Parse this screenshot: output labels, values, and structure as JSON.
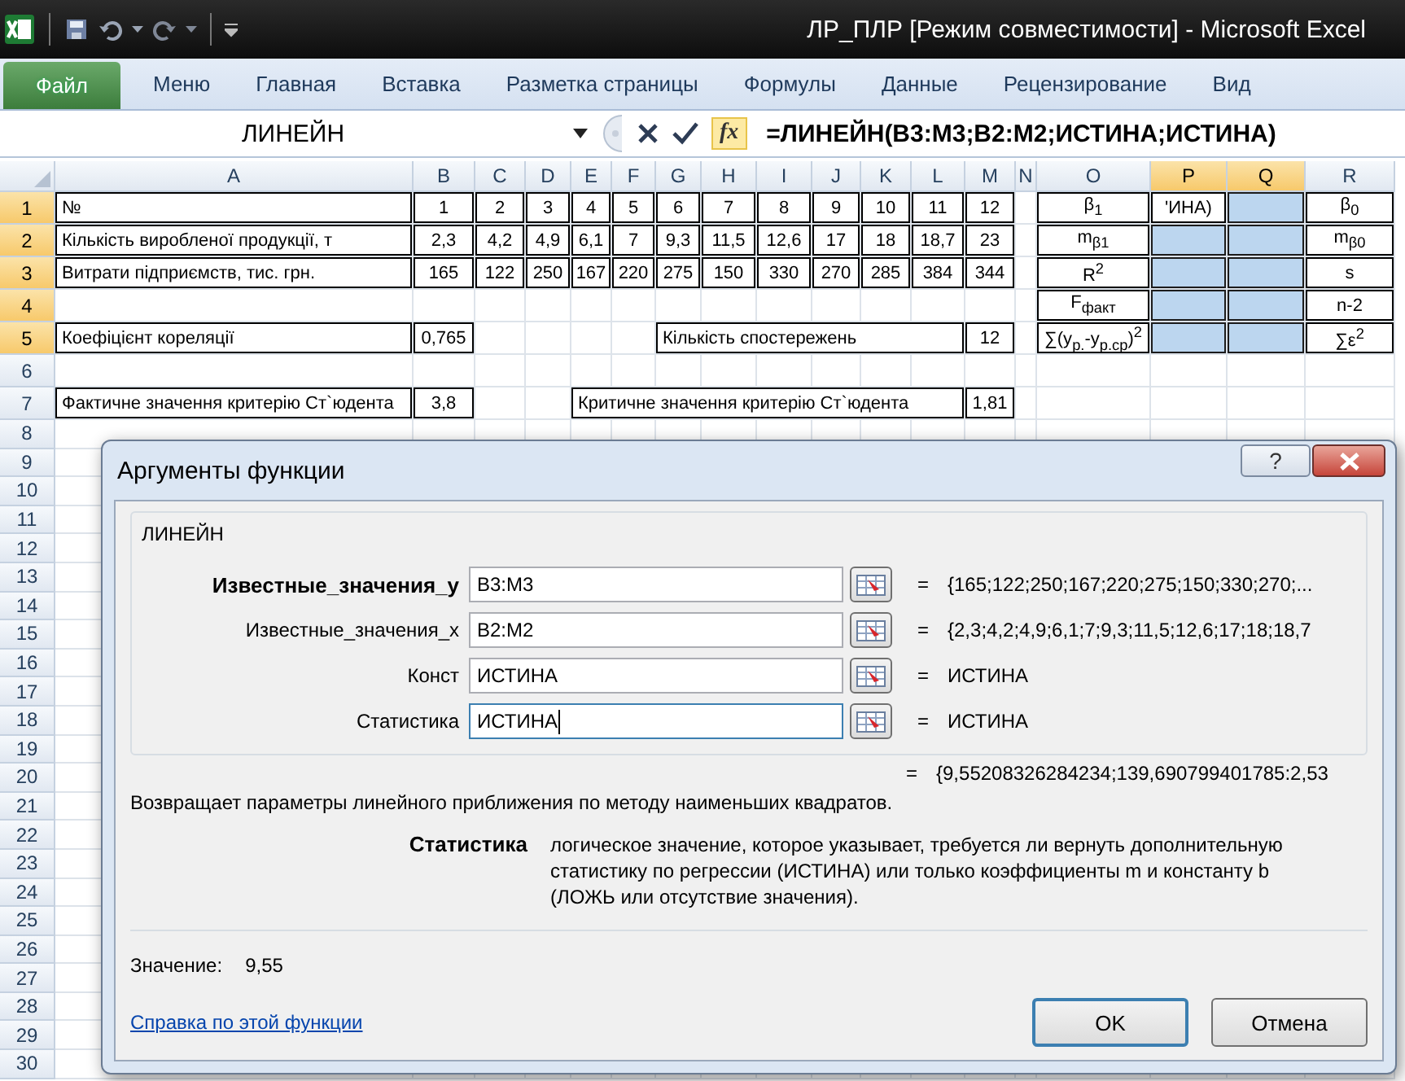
{
  "window": {
    "title": "ЛР_ПЛР  [Режим совместимости] - Microsoft Excel"
  },
  "ribbon_tabs": [
    {
      "label": "Файл",
      "kind": "file",
      "selected": false
    },
    {
      "label": "Меню",
      "kind": "tab",
      "selected": false
    },
    {
      "label": "Главная",
      "kind": "tab",
      "selected": false
    },
    {
      "label": "Вставка",
      "kind": "tab",
      "selected": false
    },
    {
      "label": "Разметка страницы",
      "kind": "tab",
      "selected": false
    },
    {
      "label": "Формулы",
      "kind": "tab",
      "selected": false
    },
    {
      "label": "Данные",
      "kind": "tab",
      "selected": false
    },
    {
      "label": "Рецензирование",
      "kind": "tab",
      "selected": false
    },
    {
      "label": "Вид",
      "kind": "tab",
      "selected": false
    }
  ],
  "formula_bar": {
    "name_box": "ЛИНЕЙН",
    "function_button": "fx",
    "formula": "=ЛИНЕЙН(B3:M3;B2:M2;ИСТИНА;ИСТИНА)"
  },
  "sheet": {
    "columns": [
      {
        "label": "A",
        "selected": false
      },
      {
        "label": "B",
        "selected": false
      },
      {
        "label": "C",
        "selected": false
      },
      {
        "label": "D",
        "selected": false
      },
      {
        "label": "E",
        "selected": false
      },
      {
        "label": "F",
        "selected": false
      },
      {
        "label": "G",
        "selected": false
      },
      {
        "label": "H",
        "selected": false
      },
      {
        "label": "I",
        "selected": false
      },
      {
        "label": "J",
        "selected": false
      },
      {
        "label": "K",
        "selected": false
      },
      {
        "label": "L",
        "selected": false
      },
      {
        "label": "M",
        "selected": false
      },
      {
        "label": "N",
        "selected": false
      },
      {
        "label": "O",
        "selected": false
      },
      {
        "label": "P",
        "selected": true
      },
      {
        "label": "Q",
        "selected": true
      },
      {
        "label": "R",
        "selected": false
      }
    ],
    "rows": [
      {
        "label": "1",
        "selected": true,
        "cells": [
          {
            "text": "№",
            "selected": false
          },
          {
            "text": "1",
            "selected": false
          },
          {
            "text": "2",
            "selected": false
          },
          {
            "text": "3",
            "selected": false
          },
          {
            "text": "4",
            "selected": false
          },
          {
            "text": "5",
            "selected": false
          },
          {
            "text": "6",
            "selected": false
          },
          {
            "text": "7",
            "selected": false
          },
          {
            "text": "8",
            "selected": false
          },
          {
            "text": "9",
            "selected": false
          },
          {
            "text": "10",
            "selected": false
          },
          {
            "text": "11",
            "selected": false
          },
          {
            "text": "12",
            "selected": false
          },
          {
            "selected": false
          },
          {
            "text": "β$_{1}$",
            "selected": false
          },
          {
            "text": "'ИНА)",
            "selected": false
          },
          {
            "selected": true
          },
          {
            "text": "β$_{0}$",
            "selected": false
          }
        ]
      },
      {
        "label": "2",
        "selected": true,
        "cells": [
          {
            "text": "Кількість виробленої продукції, т",
            "selected": false
          },
          {
            "text": "2,3",
            "selected": false
          },
          {
            "text": "4,2",
            "selected": false
          },
          {
            "text": "4,9",
            "selected": false
          },
          {
            "text": "6,1",
            "selected": false
          },
          {
            "text": "7",
            "selected": false
          },
          {
            "text": "9,3",
            "selected": false
          },
          {
            "text": "11,5",
            "selected": false
          },
          {
            "text": "12,6",
            "selected": false
          },
          {
            "text": "17",
            "selected": false
          },
          {
            "text": "18",
            "selected": false
          },
          {
            "text": "18,7",
            "selected": false
          },
          {
            "text": "23",
            "selected": false
          },
          {
            "selected": false
          },
          {
            "text": "m$_{β1}$",
            "selected": false
          },
          {
            "selected": true
          },
          {
            "selected": true
          },
          {
            "text": "m$_{β0}$",
            "selected": false
          }
        ]
      },
      {
        "label": "3",
        "selected": true,
        "cells": [
          {
            "text": "Витрати підприємств, тис. грн.",
            "selected": false
          },
          {
            "text": "165",
            "selected": false
          },
          {
            "text": "122",
            "selected": false
          },
          {
            "text": "250",
            "selected": false
          },
          {
            "text": "167",
            "selected": false
          },
          {
            "text": "220",
            "selected": false
          },
          {
            "text": "275",
            "selected": false
          },
          {
            "text": "150",
            "selected": false
          },
          {
            "text": "330",
            "selected": false
          },
          {
            "text": "270",
            "selected": false
          },
          {
            "text": "285",
            "selected": false
          },
          {
            "text": "384",
            "selected": false
          },
          {
            "text": "344",
            "selected": false
          },
          {
            "selected": false
          },
          {
            "text": "R$^{2}$",
            "selected": false
          },
          {
            "selected": true
          },
          {
            "selected": true
          },
          {
            "text": "s",
            "selected": false
          }
        ]
      },
      {
        "label": "4",
        "selected": true,
        "cells": [
          {
            "selected": false
          },
          {
            "selected": false
          },
          {
            "selected": false
          },
          {
            "selected": false
          },
          {
            "selected": false
          },
          {
            "selected": false
          },
          {
            "selected": false
          },
          {
            "selected": false
          },
          {
            "selected": false
          },
          {
            "selected": false
          },
          {
            "selected": false
          },
          {
            "selected": false
          },
          {
            "selected": false
          },
          {
            "selected": false
          },
          {
            "text": "F$_{факт}$",
            "selected": false
          },
          {
            "selected": true
          },
          {
            "selected": true
          },
          {
            "text": "n-2",
            "selected": false
          }
        ]
      },
      {
        "label": "5",
        "selected": true,
        "cells": [
          {
            "kind": "cell",
            "text": "Коефіцієнт кореляції",
            "selected": false
          },
          {
            "kind": "cell",
            "text": "0,765",
            "selected": false
          },
          {
            "kind": "cell",
            "selected": false
          },
          {
            "kind": "cell",
            "selected": false
          },
          {
            "kind": "cell",
            "selected": false
          },
          {
            "kind": "cell",
            "selected": false
          },
          {
            "kind": "merged",
            "text": "Кількість спостережень",
            "selected": false
          },
          {
            "kind": "cell",
            "text": "12",
            "selected": false
          },
          {
            "kind": "cell",
            "selected": false
          },
          {
            "kind": "cell",
            "text": "∑(y$_{р.}$-y$_{р.ср}$)$^{2}$",
            "selected": false
          },
          {
            "kind": "cell",
            "selected": true
          },
          {
            "kind": "cell",
            "selected": true
          },
          {
            "kind": "cell",
            "text": "∑ε$^{2}$",
            "selected": false
          }
        ]
      },
      {
        "label": "6",
        "selected": false
      },
      {
        "label": "7",
        "selected": false,
        "cells": [
          {
            "kind": "cell",
            "text": "Фактичне значення критерію Ст`юдента",
            "selected": false
          },
          {
            "kind": "cell",
            "text": "3,8",
            "selected": false
          },
          {
            "kind": "cell",
            "selected": false
          },
          {
            "kind": "cell",
            "selected": false
          },
          {
            "kind": "merged",
            "text": "Критичне значення критерію Ст`юдента",
            "selected": false
          },
          {
            "kind": "cell",
            "text": "1,81",
            "selected": false
          },
          {
            "kind": "cell",
            "selected": false
          },
          {
            "kind": "cell",
            "selected": false
          },
          {
            "kind": "cell",
            "selected": false
          },
          {
            "kind": "cell",
            "selected": false
          },
          {
            "kind": "cell",
            "selected": false
          }
        ]
      },
      {
        "label": "8",
        "selected": false
      },
      {
        "label": "9",
        "selected": false
      },
      {
        "label": "10",
        "selected": false
      },
      {
        "label": "11",
        "selected": false
      },
      {
        "label": "12",
        "selected": false
      },
      {
        "label": "13",
        "selected": false
      },
      {
        "label": "14",
        "selected": false
      },
      {
        "label": "15",
        "selected": false
      },
      {
        "label": "16",
        "selected": false
      },
      {
        "label": "17",
        "selected": false
      },
      {
        "label": "18",
        "selected": false
      },
      {
        "label": "19",
        "selected": false
      },
      {
        "label": "20",
        "selected": false
      },
      {
        "label": "21",
        "selected": false
      },
      {
        "label": "22",
        "selected": false
      },
      {
        "label": "23",
        "selected": false
      },
      {
        "label": "24",
        "selected": false
      },
      {
        "label": "25",
        "selected": false
      },
      {
        "label": "26",
        "selected": false
      },
      {
        "label": "27",
        "selected": false
      },
      {
        "label": "28",
        "selected": false
      },
      {
        "label": "29",
        "selected": false
      },
      {
        "label": "30",
        "selected": false
      }
    ]
  },
  "dialog": {
    "title": "Аргументы функции",
    "help_button": "?",
    "function_name": "ЛИНЕЙН",
    "arguments": [
      {
        "label": "Известные_значения_y",
        "required": true,
        "value": "B3:M3",
        "equals": "=",
        "result": "{165;122;250;167;220;275;150;330;270;...",
        "focused": false
      },
      {
        "label": "Известные_значения_x",
        "required": false,
        "value": "B2:M2",
        "equals": "=",
        "result": "{2,3;4,2;4,9;6,1;7;9,3;11,5;12,6;17;18;18,7",
        "focused": false
      },
      {
        "label": "Конст",
        "required": false,
        "value": "ИСТИНА",
        "equals": "=",
        "result": "ИСТИНА",
        "focused": false
      },
      {
        "label": "Статистика",
        "required": false,
        "value": "ИСТИНА",
        "equals": "=",
        "result": "ИСТИНА",
        "focused": true
      }
    ],
    "formula_result": {
      "equals": "=",
      "text": "{9,55208326284234;139,690799401785:2,53"
    },
    "description": "Возвращает параметры линейного приближения по методу наименьших квадратов.",
    "argument_help": {
      "name": "Статистика",
      "text": "логическое значение, которое указывает, требуется ли вернуть дополнительную статистику по регрессии (ИСТИНА) или только коэффициенты m и константу b (ЛОЖЬ или отсутствие значения)."
    },
    "value_label": "Значение:",
    "value": "9,55",
    "help_link": "Справка по этой функции",
    "buttons": [
      {
        "label": "OK",
        "default": true
      },
      {
        "label": "Отмена",
        "default": false
      }
    ]
  }
}
